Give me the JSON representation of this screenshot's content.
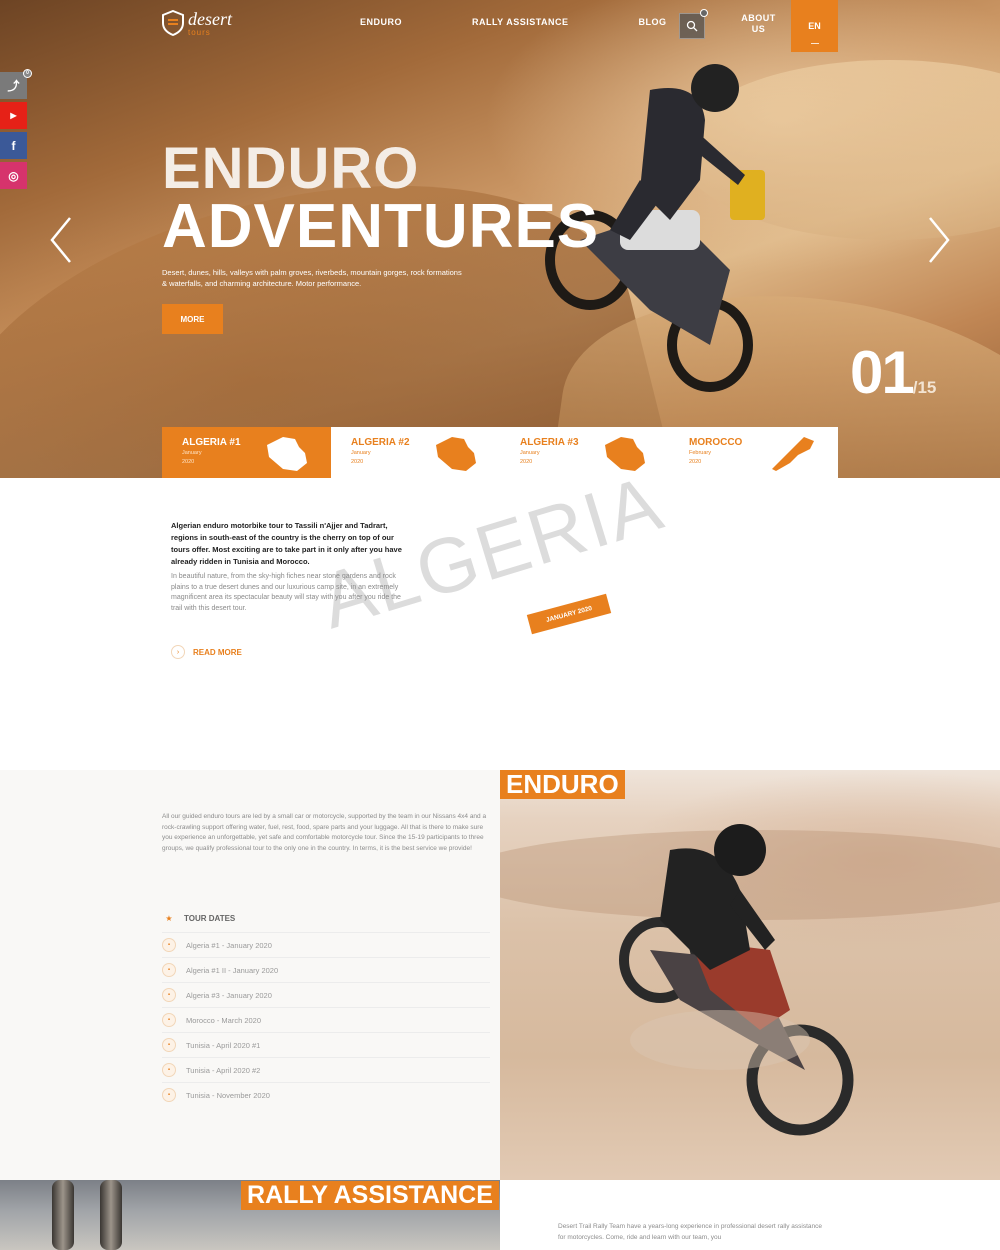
{
  "colors": {
    "accent": "#e8801e",
    "hero_text": "#ffffff",
    "muted": "#8c8c8c",
    "watermark": "#d6d6d6"
  },
  "header": {
    "logo": {
      "word": "desert",
      "sub": "tours"
    },
    "nav": [
      "ENDURO",
      "RALLY ASSISTANCE",
      "BLOG",
      "ABOUT US"
    ],
    "search_icon": "search-icon",
    "lang": "EN"
  },
  "social": [
    {
      "name": "share-icon",
      "glyph": "⤴",
      "count": "0"
    },
    {
      "name": "youtube-icon",
      "glyph": "▶"
    },
    {
      "name": "facebook-icon",
      "glyph": "f"
    },
    {
      "name": "instagram-icon",
      "glyph": "◎"
    }
  ],
  "hero": {
    "title_line1": "ENDURO",
    "title_line2": "ADVENTURES",
    "text": "Desert, dunes, hills, valleys with palm groves, riverbeds, mountain gorges, rock formations & waterfalls, and charming architecture. Motor performance.",
    "button": "MORE",
    "counter_current": "01",
    "counter_total": "/15"
  },
  "tabs": [
    {
      "name": "ALGERIA #1",
      "sub1": "January",
      "sub2": "2020",
      "active": true
    },
    {
      "name": "ALGERIA #2",
      "sub1": "January",
      "sub2": "2020",
      "active": false
    },
    {
      "name": "ALGERIA #3",
      "sub1": "January",
      "sub2": "2020",
      "active": false
    },
    {
      "name": "MOROCCO",
      "sub1": "February",
      "sub2": "2020",
      "active": false
    }
  ],
  "intro": {
    "watermark": "ALGERIA",
    "bold_text": "Algerian enduro motorbike tour to Tassili n'Ajjer and Tadrart, regions in south-east of the country is the cherry on top of our tours offer. Most exciting are to take part in it only after you have already ridden in Tunisia and Morocco.",
    "text": "In beautiful nature, from the sky-high fiches near stone gardens and rock plains to a true desert dunes and our luxurious camp site, in an extremely magnificent area its spectacular beauty will stay with you after you ride the trail with this desert tour.",
    "date_tag": "JANUARY 2020",
    "read_more": "READ MORE"
  },
  "enduro": {
    "label": "ENDURO",
    "text": "All our guided enduro tours are led by a small car or motorcycle, supported by the team in our Nissans 4x4 and a rock-crawling support offering water, fuel, rest, food, spare parts and your luggage. All that is there to make sure you experience an unforgettable, yet safe and comfortable motorcycle tour. Since the 15-19 participants to three groups, we qualify professional tour to the only one in the country. In terms, it is the best service we provide!",
    "tour_dates_label": "TOUR DATES",
    "tour_dates": [
      "Algeria #1 - January 2020",
      "Algeria #1 II - January 2020",
      "Algeria #3 - January 2020",
      "Morocco - March 2020",
      "Tunisia - April 2020 #1",
      "Tunisia - April 2020 #2",
      "Tunisia - November 2020"
    ]
  },
  "rally": {
    "label": "RALLY ASSISTANCE",
    "text": "Desert Trail Rally Team have a years-long experience in professional desert rally assistance for motorcycles. Come, ride and learn with our team, you"
  }
}
